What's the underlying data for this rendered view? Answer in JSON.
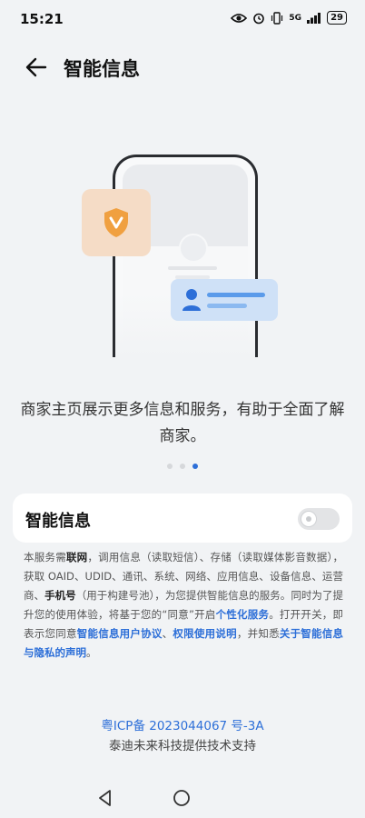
{
  "status_bar": {
    "time": "15:21",
    "signal_label": "5G",
    "battery": "29"
  },
  "header": {
    "title": "智能信息"
  },
  "main": {
    "description": "商家主页展示更多信息和服务，有助于全面了解商家。",
    "pager": {
      "total": 3,
      "active_index": 2
    },
    "toggle": {
      "label": "智能信息",
      "on": false
    }
  },
  "legal": {
    "p1": "本服务需",
    "b1": "联网",
    "p2": "，调用信息（读取短信）、存储（读取媒体影音数据），获取 OAID、UDID、通讯、系统、网络、应用信息、设备信息、运营商、",
    "b2": "手机号",
    "p3": "（用于构建号池），为您提供智能信息的服务。同时为了提升您的使用体验，将基于您的“同意”开启",
    "l1": "个性化服务",
    "p4": "。打开开关，即表示您同意",
    "l2": "智能信息用户协议",
    "p5": "、",
    "l3": "权限使用说明",
    "p6": "，并知悉",
    "l4": "关于智能信息与隐私的声明",
    "p7": "。"
  },
  "footer": {
    "icp": "粤ICP备 2023044067 号-3A",
    "support": "泰迪未来科技提供技术支持"
  },
  "colors": {
    "accent": "#2d6fd8",
    "background": "#f1f3f5",
    "shield_orange": "#f0a040"
  },
  "icons": [
    "back-arrow-icon",
    "shield-icon",
    "person-icon",
    "nav-back-icon",
    "nav-home-icon"
  ]
}
